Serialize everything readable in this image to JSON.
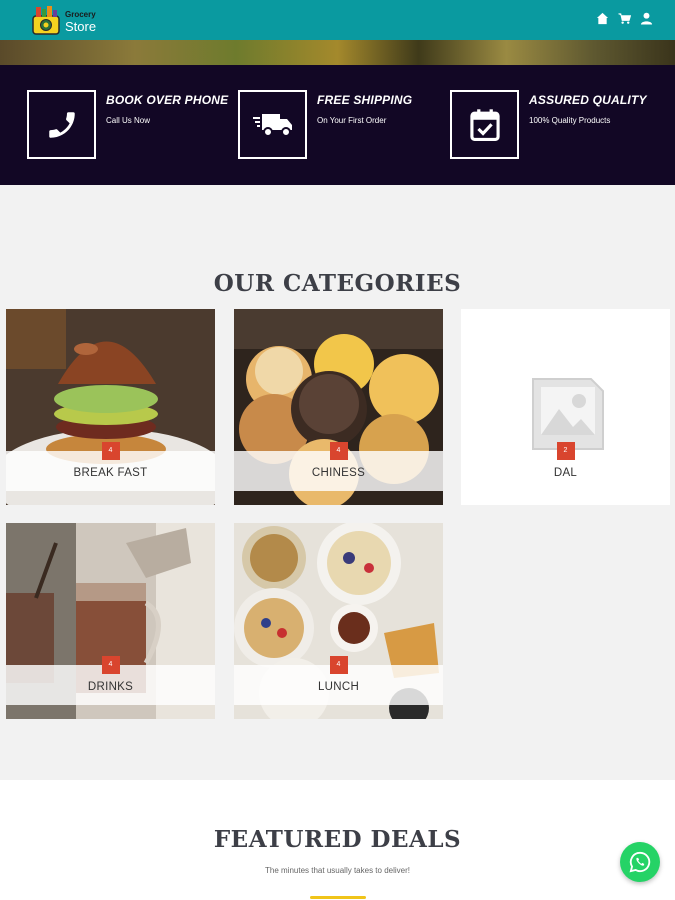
{
  "header": {
    "logo_line1": "Grocery",
    "logo_line2": "Store",
    "icons": [
      "home-icon",
      "cart-icon",
      "user-icon"
    ],
    "background": "#0a9aa0"
  },
  "features": [
    {
      "title": "BOOK OVER PHONE",
      "subtitle": "Call Us Now",
      "icon": "phone-icon"
    },
    {
      "title": "FREE SHIPPING",
      "subtitle": "On Your First Order",
      "icon": "truck-icon"
    },
    {
      "title": "ASSURED QUALITY",
      "subtitle": "100% Quality Products",
      "icon": "calendar-check-icon"
    }
  ],
  "categories": {
    "title": "OUR CATEGORIES",
    "items": [
      {
        "name": "BREAK FAST",
        "count": "4"
      },
      {
        "name": "CHINESS",
        "count": "4"
      },
      {
        "name": "DAL",
        "count": "2"
      },
      {
        "name": "DRINKS",
        "count": "4"
      },
      {
        "name": "LUNCH",
        "count": "4"
      }
    ]
  },
  "featured": {
    "title": "FEATURED DEALS",
    "subtitle": "The minutes that usually takes to deliver!"
  },
  "colors": {
    "teal": "#0a9aa0",
    "navy": "#120725",
    "badge_red": "#d9452e",
    "whatsapp": "#25d366"
  }
}
